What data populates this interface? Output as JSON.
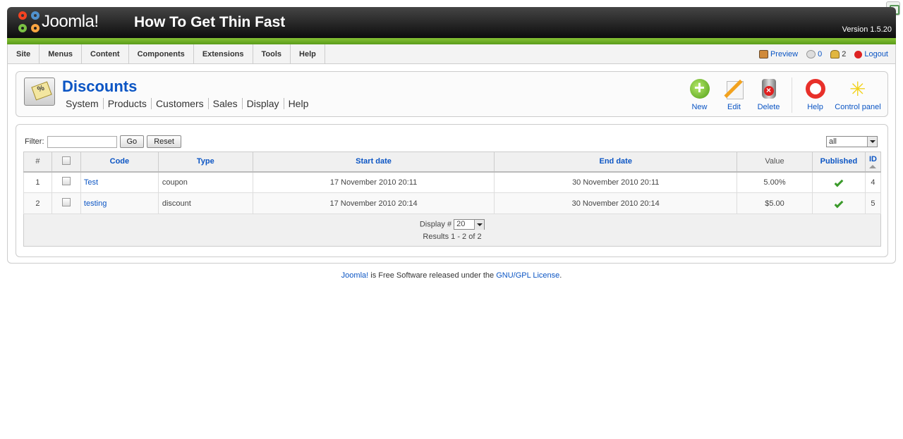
{
  "header": {
    "logo_text": "Joomla!",
    "site_title": "How To Get Thin Fast",
    "version": "Version 1.5.20"
  },
  "menu": [
    "Site",
    "Menus",
    "Content",
    "Components",
    "Extensions",
    "Tools",
    "Help"
  ],
  "status": {
    "preview": "Preview",
    "messages": "0",
    "users": "2",
    "logout": "Logout"
  },
  "toolbar": {
    "title": "Discounts",
    "submenu": [
      "System",
      "Products",
      "Customers",
      "Sales",
      "Display",
      "Help"
    ],
    "buttons": {
      "new": "New",
      "edit": "Edit",
      "delete": "Delete",
      "help": "Help",
      "control_panel": "Control panel"
    }
  },
  "filter": {
    "label": "Filter:",
    "value": "",
    "go": "Go",
    "reset": "Reset",
    "state": "all"
  },
  "table": {
    "headers": {
      "num": "#",
      "code": "Code",
      "type": "Type",
      "start": "Start date",
      "end": "End date",
      "value": "Value",
      "published": "Published",
      "id": "ID"
    },
    "rows": [
      {
        "num": "1",
        "code": "Test",
        "type": "coupon",
        "start": "17 November 2010 20:11",
        "end": "30 November 2010 20:11",
        "value": "5.00%",
        "published": true,
        "id": "4"
      },
      {
        "num": "2",
        "code": "testing",
        "type": "discount",
        "start": "17 November 2010 20:14",
        "end": "30 November 2010 20:14",
        "value": "$5.00",
        "published": true,
        "id": "5"
      }
    ],
    "display_label": "Display #",
    "display_value": "20",
    "results": "Results 1 - 2 of 2"
  },
  "footer": {
    "joomla": "Joomla!",
    "text": " is Free Software released under the ",
    "license": "GNU/GPL License",
    "dot": "."
  }
}
